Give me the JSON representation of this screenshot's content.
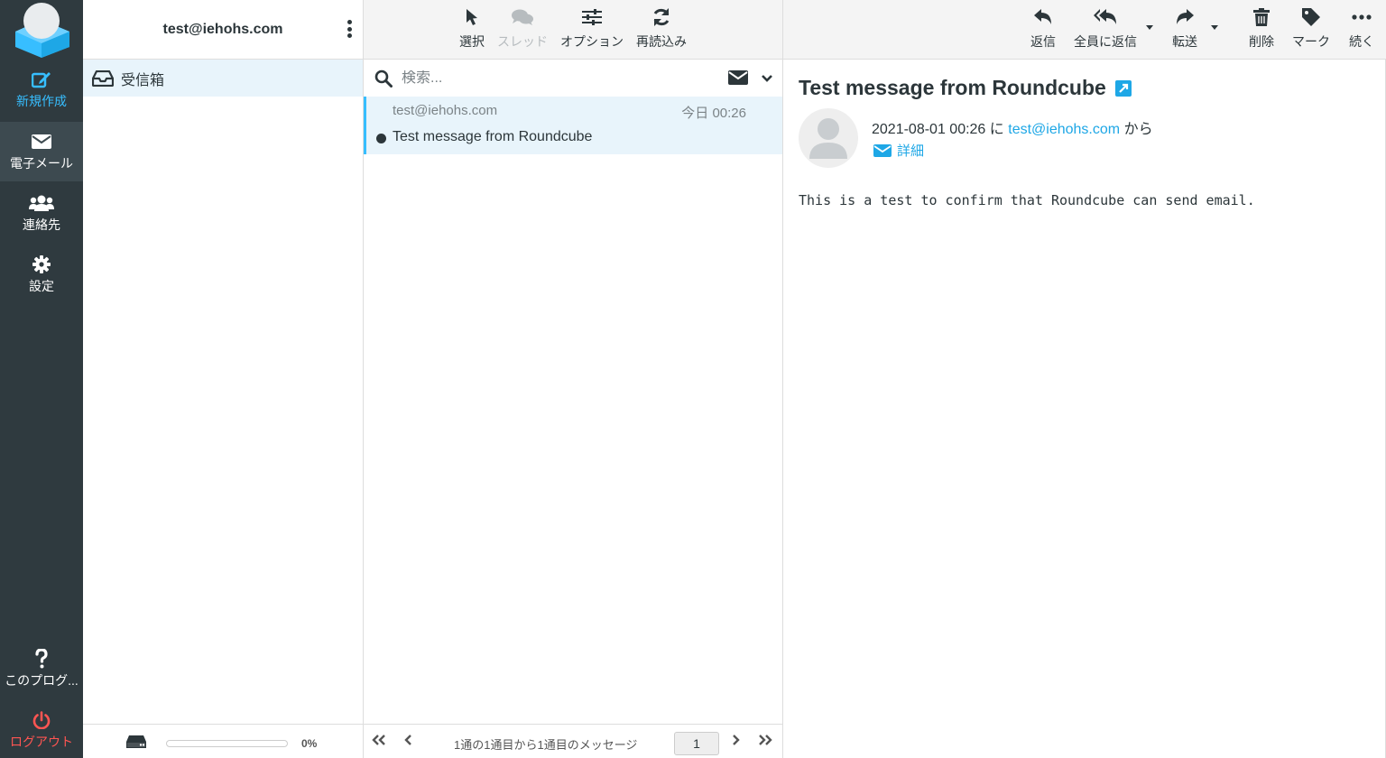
{
  "nav": {
    "compose": "新規作成",
    "mail": "電子メール",
    "contacts": "連絡先",
    "settings": "設定",
    "about": "このプログ...",
    "logout": "ログアウト"
  },
  "folders": {
    "account": "test@iehohs.com",
    "items": [
      {
        "label": "受信箱",
        "icon": "inbox-icon"
      }
    ],
    "quota": "0%"
  },
  "list_toolbar": {
    "select": "選択",
    "threads": "スレッド",
    "options": "オプション",
    "refresh": "再読込み"
  },
  "search": {
    "placeholder": "検索..."
  },
  "messages": [
    {
      "from": "test@iehohs.com",
      "date": "今日 00:26",
      "subject": "Test message from Roundcube",
      "unread": true
    }
  ],
  "pagination": {
    "count_text": "1通の1通目から1通目のメッセージ",
    "page": "1"
  },
  "preview_toolbar": {
    "reply": "返信",
    "reply_all": "全員に返信",
    "forward": "転送",
    "delete": "削除",
    "mark": "マーク",
    "more": "続く"
  },
  "message": {
    "subject": "Test message from Roundcube",
    "date": "2021-08-01 00:26",
    "from_prefix": "に",
    "from": "test@iehohs.com",
    "from_suffix": "から",
    "details": "詳細",
    "body": "This is a test to confirm that Roundcube can send email."
  },
  "colors": {
    "accent": "#37beff",
    "nav_bg": "#2f3a3f",
    "logout": "#ff5552",
    "selected_bg": "#e8f4fb"
  }
}
